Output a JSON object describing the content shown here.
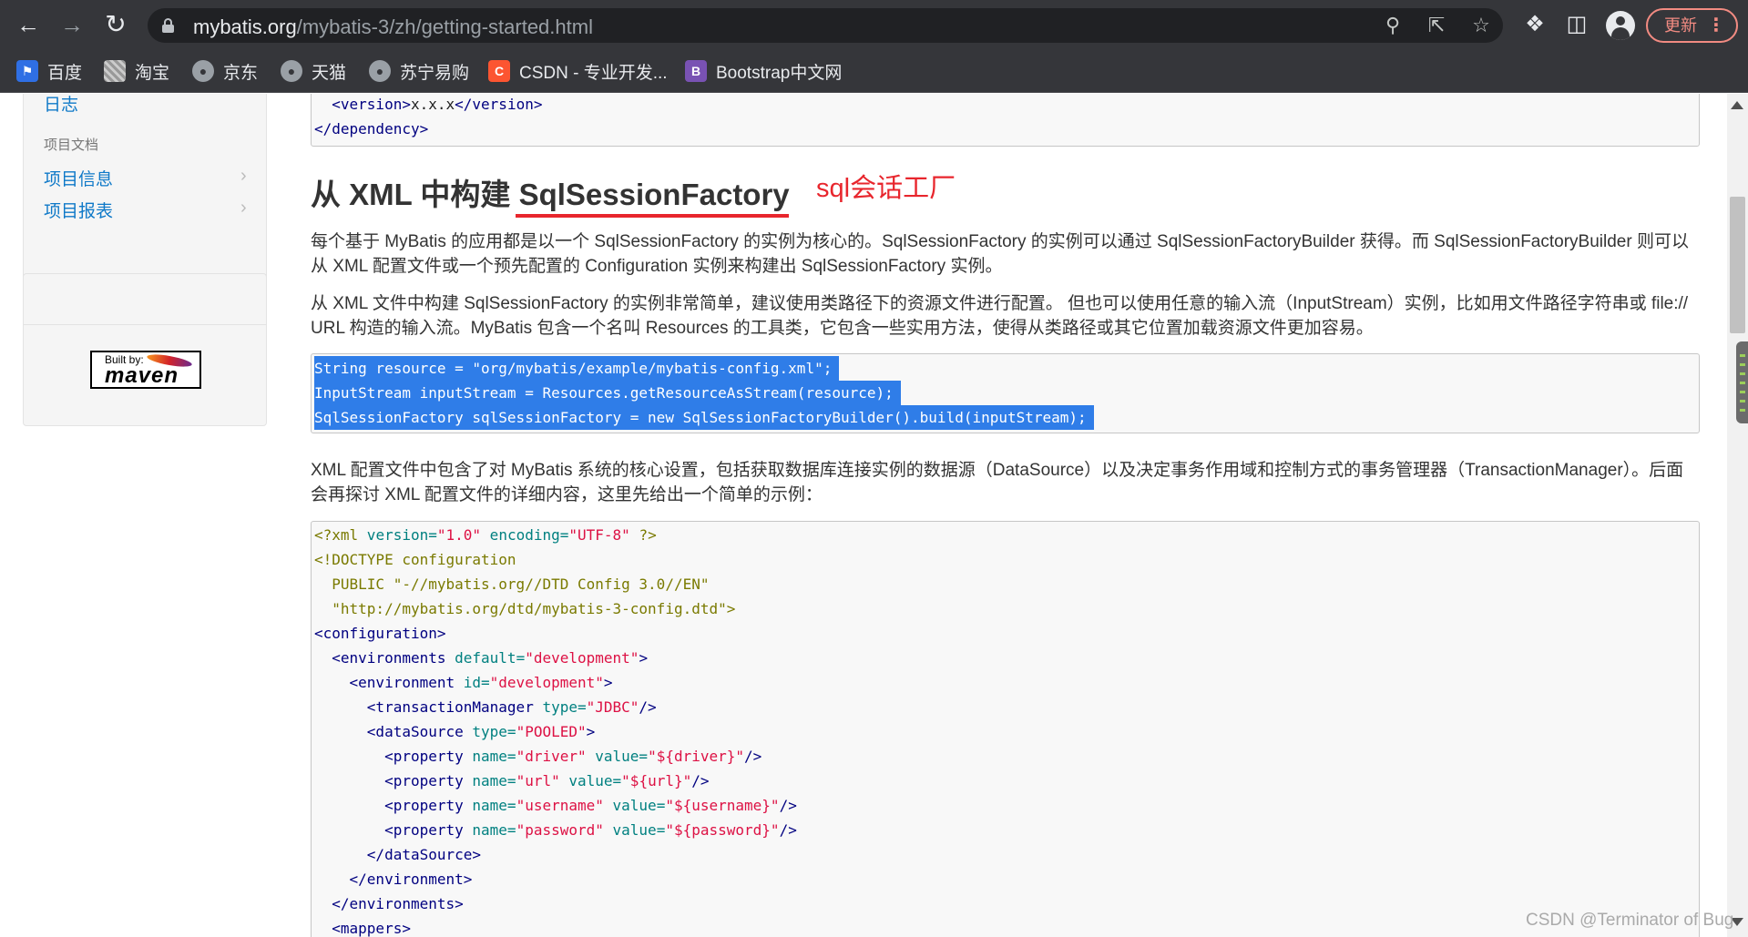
{
  "browser": {
    "url_host": "mybatis.org",
    "url_path": "/mybatis-3/zh/getting-started.html",
    "update_label": "更新",
    "bookmarks": [
      {
        "label": "百度",
        "icon": "baidu-icon"
      },
      {
        "label": "淘宝",
        "icon": "taobao-icon"
      },
      {
        "label": "京东",
        "icon": "globe-icon"
      },
      {
        "label": "天猫",
        "icon": "globe-icon"
      },
      {
        "label": "苏宁易购",
        "icon": "globe-icon"
      },
      {
        "label": "CSDN - 专业开发...",
        "icon": "csdn-icon"
      },
      {
        "label": "Bootstrap中文网",
        "icon": "bootstrap-icon"
      }
    ]
  },
  "sidebar": {
    "log_link": "日志",
    "section_heading": "项目文档",
    "items": [
      "项目信息",
      "项目报表"
    ],
    "maven_built_by": "Built by:",
    "maven_name": "maven"
  },
  "content": {
    "top_code": {
      "line1_open": "<version>",
      "line1_value": "x.x.x",
      "line1_close": "</version>",
      "line2": "</dependency>"
    },
    "heading": "从 XML 中构建 SqlSessionFactory",
    "annotation": "sql会话工厂",
    "para1": "每个基于 MyBatis 的应用都是以一个 SqlSessionFactory 的实例为核心的。SqlSessionFactory 的实例可以通过 SqlSessionFactoryBuilder 获得。而 SqlSessionFactoryBuilder 则可以从 XML 配置文件或一个预先配置的 Configuration 实例来构建出 SqlSessionFactory 实例。",
    "para2": "从 XML 文件中构建 SqlSessionFactory 的实例非常简单，建议使用类路径下的资源文件进行配置。 但也可以使用任意的输入流（InputStream）实例，比如用文件路径字符串或 file:// URL 构造的输入流。MyBatis 包含一个名叫 Resources 的工具类，它包含一些实用方法，使得从类路径或其它位置加载资源文件更加容易。",
    "java_code": [
      "String resource = \"org/mybatis/example/mybatis-config.xml\";",
      "InputStream inputStream = Resources.getResourceAsStream(resource);",
      "SqlSessionFactory sqlSessionFactory = new SqlSessionFactoryBuilder().build(inputStream);"
    ],
    "para3": "XML 配置文件中包含了对 MyBatis 系统的核心设置，包括获取数据库连接实例的数据源（DataSource）以及决定事务作用域和控制方式的事务管理器（TransactionManager）。后面会再探讨 XML 配置文件的详细内容，这里先给出一个简单的示例：",
    "xml_code": {
      "l1_a": "<?xml",
      "l1_b": " version=",
      "l1_c": "\"1.0\"",
      "l1_d": " encoding=",
      "l1_e": "\"UTF-8\"",
      "l1_f": " ?>",
      "l2": "<!DOCTYPE configuration",
      "l3": "  PUBLIC \"-//mybatis.org//DTD Config 3.0//EN\"",
      "l4": "  \"http://mybatis.org/dtd/mybatis-3-config.dtd\">",
      "l5": "<configuration>",
      "l6_t": "  <environments",
      "l6_a": " default=",
      "l6_v": "\"development\"",
      "l6_c": ">",
      "l7_t": "    <environment",
      "l7_a": " id=",
      "l7_v": "\"development\"",
      "l7_c": ">",
      "l8_t": "      <transactionManager",
      "l8_a": " type=",
      "l8_v": "\"JDBC\"",
      "l8_c": "/>",
      "l9_t": "      <dataSource",
      "l9_a": " type=",
      "l9_v": "\"POOLED\"",
      "l9_c": ">",
      "props": [
        {
          "name": "\"driver\"",
          "value": "\"${driver}\""
        },
        {
          "name": "\"url\"",
          "value": "\"${url}\""
        },
        {
          "name": "\"username\"",
          "value": "\"${username}\""
        },
        {
          "name": "\"password\"",
          "value": "\"${password}\""
        }
      ],
      "prop_open": "        <property",
      "prop_name": " name=",
      "prop_value": " value=",
      "prop_close": "/>",
      "l14": "      </dataSource>",
      "l15": "    </environment>",
      "l16": "  </environments>",
      "l17": "  <mappers>"
    }
  },
  "watermark": "CSDN @Terminator of Bug"
}
